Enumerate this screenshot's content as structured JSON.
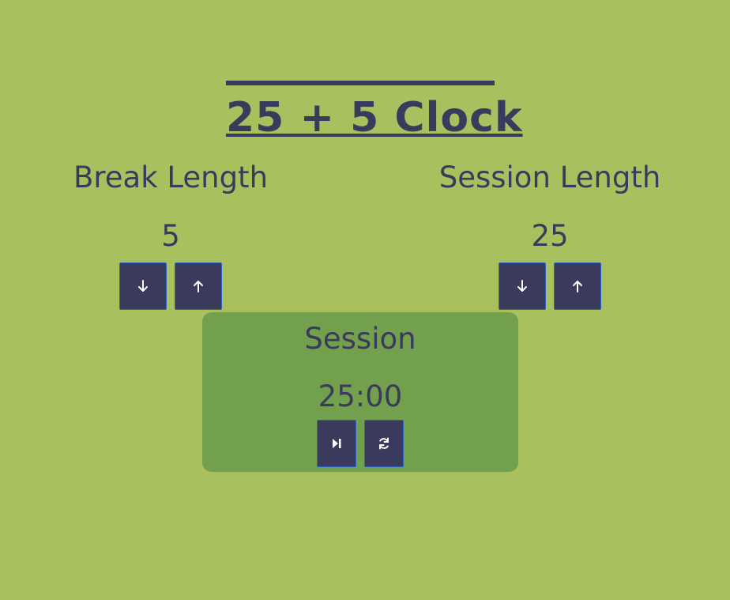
{
  "app": {
    "title": "25 + 5 Clock"
  },
  "break": {
    "label": "Break Length",
    "value": "5",
    "decrement_icon": "arrow-down-icon",
    "increment_icon": "arrow-up-icon"
  },
  "session": {
    "label": "Session Length",
    "value": "25",
    "decrement_icon": "arrow-down-icon",
    "increment_icon": "arrow-up-icon"
  },
  "timer": {
    "label": "Session",
    "time_left": "25:00",
    "play_icon": "play-pause-icon",
    "reset_icon": "refresh-icon"
  },
  "colors": {
    "background": "#a8c15e",
    "timer_panel": "#72a04c",
    "text": "#3a3a5c",
    "button": "#3a3a5c",
    "button_border": "#2e63c9"
  }
}
